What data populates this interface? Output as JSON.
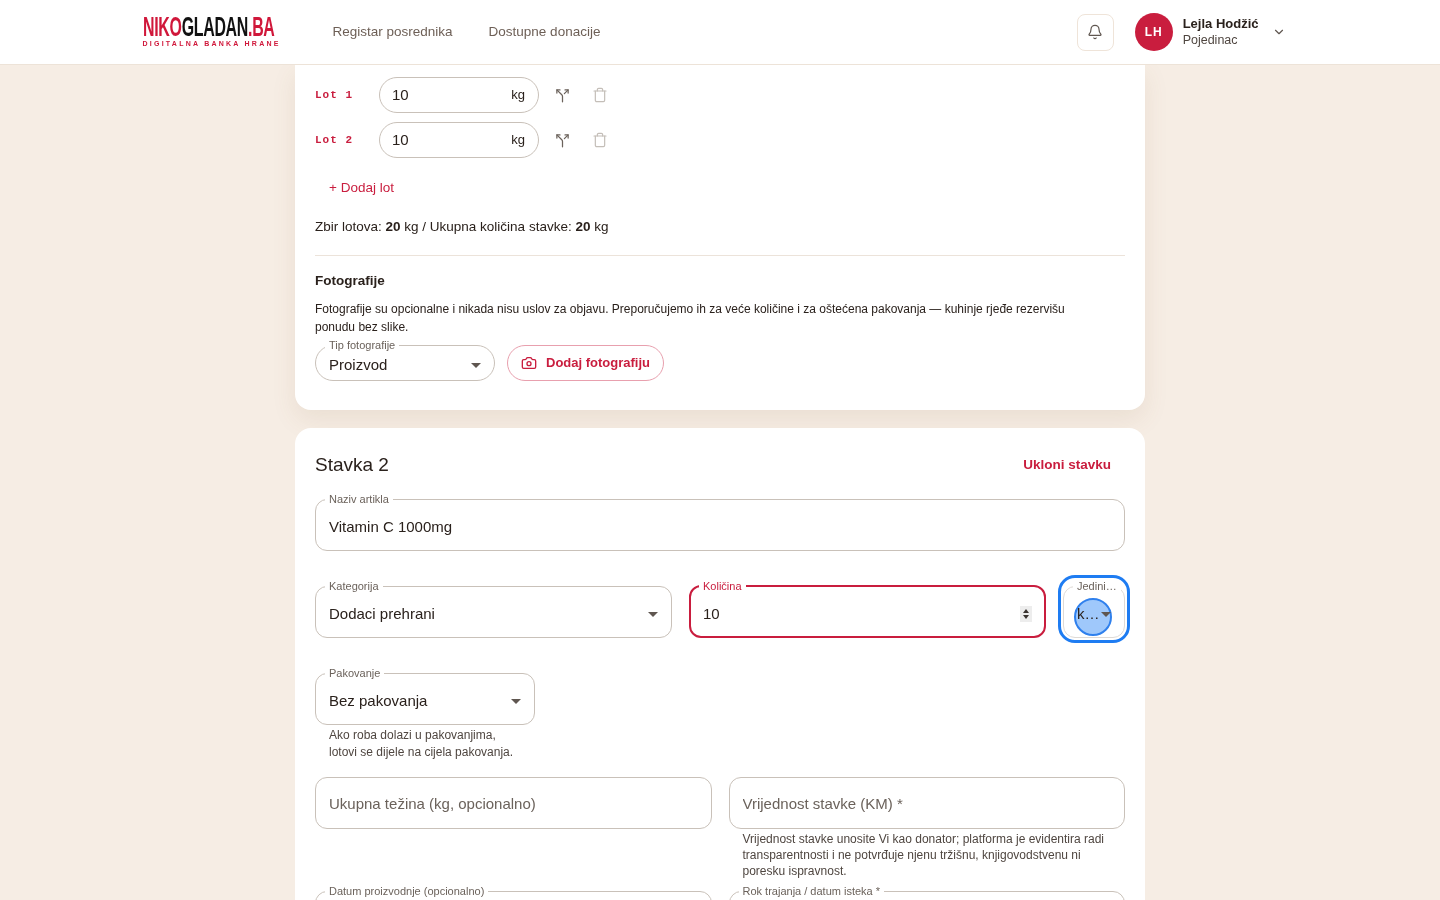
{
  "header": {
    "logo": {
      "part_1": "NIKO",
      "part_2": "GLADAN",
      "part_3": ".BA",
      "tagline": "DIGITALNA BANKA HRANE"
    },
    "nav": [
      {
        "label": "Registar posrednika"
      },
      {
        "label": "Dostupne donacije"
      }
    ],
    "user": {
      "initials": "LH",
      "name": "Lejla Hodžić",
      "role": "Pojedinac"
    }
  },
  "item_1": {
    "lots": [
      {
        "label": "Lot 1",
        "value": "10",
        "unit": "kg",
        "delete_disabled": true
      },
      {
        "label": "Lot 2",
        "value": "10",
        "unit": "kg",
        "delete_disabled": true
      }
    ],
    "add_lot": "+ Dodaj lot",
    "summary": "Zbir lotova: **20** kg / Ukupna količina stavke: **20** kg",
    "photos": {
      "title": "Fotografije",
      "description": "Fotografije su opcionalne i nikada nisu uslov za objavu. Preporučujemo ih za veće količine i za oštećena pakovanja — kuhinje rjeđe rezervišu ponudu bez slike.",
      "type_select": {
        "label": "Tip fotografije",
        "value": "Proizvod"
      },
      "add_button": "Dodaj fotografiju"
    }
  },
  "item_2": {
    "title": "Stavka 2",
    "remove_button": "Ukloni stavku",
    "article_name": {
      "label": "Naziv artikla",
      "value": "Vitamin C 1000mg"
    },
    "category": {
      "label": "Kategorija",
      "value": "Dodaci prehrani"
    },
    "quantity": {
      "label": "Količina",
      "value": "10",
      "active": true
    },
    "unit": {
      "label": "Jedini…",
      "value": "k…",
      "focus_ring": true,
      "click_marker": true
    },
    "packaging": {
      "label": "Pakovanje",
      "value": "Bez pakovanja",
      "helper": "Ako roba dolazi u pakovanjima, lotovi se dijele na cijela pakovanja."
    },
    "total_weight": {
      "placeholder": "Ukupna težina (kg, opcionalno)"
    },
    "item_value": {
      "placeholder": "Vrijednost stavke (KM) *",
      "helper": "Vrijednost stavke unosite Vi kao donator; platforma je evidentira radi transparentnosti i ne potvrđuje njenu tržišnu, knjigovodstvenu ni poresku ispravnost."
    },
    "production_date": {
      "label": "Datum proizvodnje (opcionalno)"
    },
    "expiry_date": {
      "label": "Rok trajanja / datum isteka *"
    }
  }
}
